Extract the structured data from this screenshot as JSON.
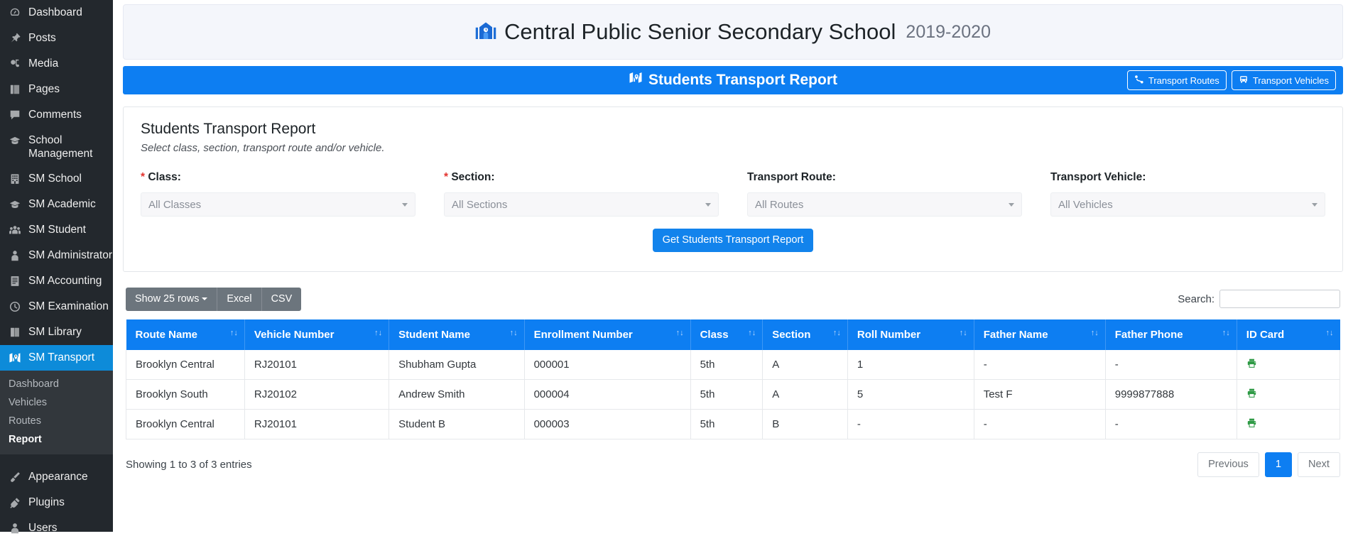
{
  "sidebar": {
    "items": [
      {
        "label": "Dashboard",
        "icon": "dashboard-icon"
      },
      {
        "label": "Posts",
        "icon": "pin-icon"
      },
      {
        "label": "Media",
        "icon": "media-icon"
      },
      {
        "label": "Pages",
        "icon": "pages-icon"
      },
      {
        "label": "Comments",
        "icon": "comment-icon"
      },
      {
        "label": "School Management",
        "icon": "graduation-cap-icon"
      },
      {
        "label": "SM School",
        "icon": "building-icon"
      },
      {
        "label": "SM Academic",
        "icon": "graduation-cap-icon"
      },
      {
        "label": "SM Student",
        "icon": "users-icon"
      },
      {
        "label": "SM Administrator",
        "icon": "user-tie-icon"
      },
      {
        "label": "SM Accounting",
        "icon": "ledger-icon"
      },
      {
        "label": "SM Examination",
        "icon": "clock-icon"
      },
      {
        "label": "SM Library",
        "icon": "book-icon"
      },
      {
        "label": "SM Transport",
        "icon": "map-marked-icon"
      }
    ],
    "active_item": "SM Transport",
    "submenu": [
      {
        "label": "Dashboard",
        "current": false
      },
      {
        "label": "Vehicles",
        "current": false
      },
      {
        "label": "Routes",
        "current": false
      },
      {
        "label": "Report",
        "current": true
      }
    ],
    "bottom_items": [
      {
        "label": "Appearance",
        "icon": "brush-icon"
      },
      {
        "label": "Plugins",
        "icon": "plug-icon"
      },
      {
        "label": "Users",
        "icon": "user-icon"
      }
    ]
  },
  "header": {
    "school_name": "Central Public Senior Secondary School",
    "session": "2019-2020",
    "icon": "school-building-icon"
  },
  "title_bar": {
    "title": "Students Transport Report",
    "icon": "map-marked-icon",
    "buttons": [
      {
        "label": "Transport Routes",
        "icon": "route-icon"
      },
      {
        "label": "Transport Vehicles",
        "icon": "bus-icon"
      }
    ]
  },
  "filter_card": {
    "heading": "Students Transport Report",
    "subtitle": "Select class, section, transport route and/or vehicle.",
    "fields": [
      {
        "label": "Class:",
        "required": true,
        "value": "All Classes"
      },
      {
        "label": "Section:",
        "required": true,
        "value": "All Sections"
      },
      {
        "label": "Transport Route:",
        "required": false,
        "value": "All Routes"
      },
      {
        "label": "Transport Vehicle:",
        "required": false,
        "value": "All Vehicles"
      }
    ],
    "submit_label": "Get Students Transport Report"
  },
  "table_toolbar": {
    "show_rows_label": "Show 25 rows",
    "excel_label": "Excel",
    "csv_label": "CSV",
    "search_label": "Search:",
    "search_value": "",
    "search_placeholder": ""
  },
  "table": {
    "columns": [
      "Route Name",
      "Vehicle Number",
      "Student Name",
      "Enrollment Number",
      "Class",
      "Section",
      "Roll Number",
      "Father Name",
      "Father Phone",
      "ID Card"
    ],
    "rows": [
      {
        "route_name": "Brooklyn Central",
        "vehicle_number": "RJ20101",
        "student_name": "Shubham Gupta",
        "enrollment_number": "000001",
        "class": "5th",
        "section": "A",
        "roll_number": "1",
        "father_name": "-",
        "father_phone": "-",
        "id_card_icon": "print-icon"
      },
      {
        "route_name": "Brooklyn South",
        "vehicle_number": "RJ20102",
        "student_name": "Andrew Smith",
        "enrollment_number": "000004",
        "class": "5th",
        "section": "A",
        "roll_number": "5",
        "father_name": "Test F",
        "father_phone": "9999877888",
        "id_card_icon": "print-icon"
      },
      {
        "route_name": "Brooklyn Central",
        "vehicle_number": "RJ20101",
        "student_name": "Student B",
        "enrollment_number": "000003",
        "class": "5th",
        "section": "B",
        "roll_number": "-",
        "father_name": "-",
        "father_phone": "-",
        "id_card_icon": "print-icon"
      }
    ]
  },
  "table_footer": {
    "entries_info": "Showing 1 to 3 of 3 entries",
    "previous_label": "Previous",
    "page_label": "1",
    "next_label": "Next"
  },
  "colors": {
    "brand_blue": "#0d7ef2",
    "sidebar_bg": "#23282d",
    "sidebar_active": "#0d8bd9",
    "required_red": "#e3342f",
    "print_green": "#2e9a45",
    "toolbar_grey": "#6c757d"
  }
}
